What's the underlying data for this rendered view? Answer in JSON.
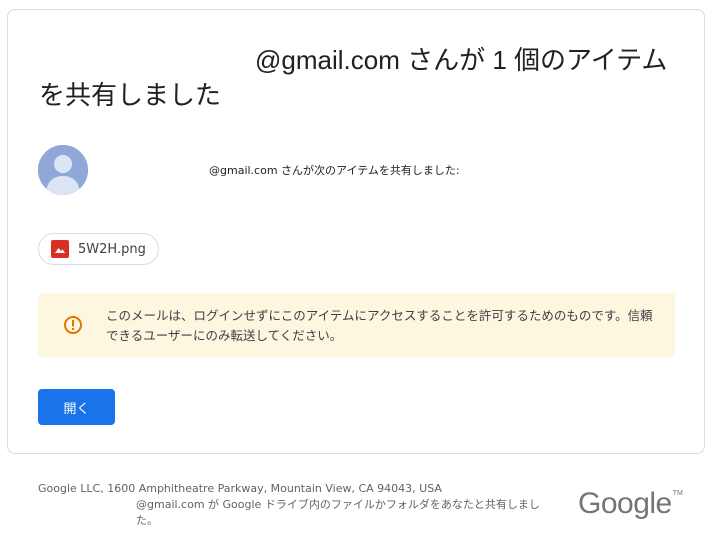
{
  "email": {
    "headline": "@gmail.com さんが 1 個のアイテムを共有しました",
    "shared_line": "@gmail.com さんが次のアイテムを共有しました:",
    "file": {
      "name": "5W2H.png",
      "icon": "image-icon",
      "icon_color": "#d93025"
    },
    "notice": {
      "icon": "warning-circle-icon",
      "icon_color": "#e37400",
      "background": "#fef7e0",
      "text": "このメールは、ログインせずにこのアイテムにアクセスすることを許可するためのものです。信頼できるユーザーにのみ転送してください。"
    },
    "open_button": {
      "label": "開く",
      "color": "#1a73e8"
    }
  },
  "footer": {
    "address": "Google LLC, 1600 Amphitheatre Parkway, Mountain View, CA 94043, USA",
    "reason": "@gmail.com が Google ドライブ内のファイルかフォルダをあなたと共有しました。",
    "logo_text": "Google",
    "logo_tm": "TM"
  }
}
